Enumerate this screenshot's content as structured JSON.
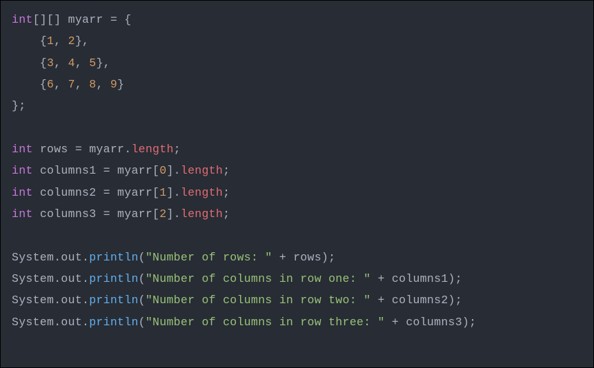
{
  "language": "java",
  "code": {
    "line1": {
      "kw": "int",
      "brackets": "[][] ",
      "var": "myarr ",
      "eq": "= ",
      "brace": "{"
    },
    "arr_row1": "    {",
    "arr_row1_v1": "1",
    "arr_row1_c1": ", ",
    "arr_row1_v2": "2",
    "arr_row1_end": "},",
    "arr_row2": "    {",
    "arr_row2_v1": "3",
    "arr_row2_c1": ", ",
    "arr_row2_v2": "4",
    "arr_row2_c2": ", ",
    "arr_row2_v3": "5",
    "arr_row2_end": "},",
    "arr_row3": "    {",
    "arr_row3_v1": "6",
    "arr_row3_c1": ", ",
    "arr_row3_v2": "7",
    "arr_row3_c2": ", ",
    "arr_row3_v3": "8",
    "arr_row3_c3": ", ",
    "arr_row3_v4": "9",
    "arr_row3_end": "}",
    "close": "};",
    "blank": " ",
    "rows_decl": {
      "kw": "int",
      "sp": " ",
      "var": "rows ",
      "eq": "= ",
      "src": "myarr",
      "dot": ".",
      "prop": "length",
      "semi": ";"
    },
    "col1_decl": {
      "kw": "int",
      "sp": " ",
      "var": "columns1 ",
      "eq": "= ",
      "src": "myarr[",
      "idx": "0",
      "rb": "]",
      "dot": ".",
      "prop": "length",
      "semi": ";"
    },
    "col2_decl": {
      "kw": "int",
      "sp": " ",
      "var": "columns2 ",
      "eq": "= ",
      "src": "myarr[",
      "idx": "1",
      "rb": "]",
      "dot": ".",
      "prop": "length",
      "semi": ";"
    },
    "col3_decl": {
      "kw": "int",
      "sp": " ",
      "var": "columns3 ",
      "eq": "= ",
      "src": "myarr[",
      "idx": "2",
      "rb": "]",
      "dot": ".",
      "prop": "length",
      "semi": ";"
    },
    "p1": {
      "sys": "System",
      "d1": ".",
      "out": "out",
      "d2": ".",
      "m": "println",
      "lp": "(",
      "str": "\"Number of rows: \"",
      "plus": " + ",
      "var": "rows",
      "rp": ");"
    },
    "p2": {
      "sys": "System",
      "d1": ".",
      "out": "out",
      "d2": ".",
      "m": "println",
      "lp": "(",
      "str": "\"Number of columns in row one: \"",
      "plus": " + ",
      "var": "columns1",
      "rp": ");"
    },
    "p3": {
      "sys": "System",
      "d1": ".",
      "out": "out",
      "d2": ".",
      "m": "println",
      "lp": "(",
      "str": "\"Number of columns in row two: \"",
      "plus": " + ",
      "var": "columns2",
      "rp": ");"
    },
    "p4": {
      "sys": "System",
      "d1": ".",
      "out": "out",
      "d2": ".",
      "m": "println",
      "lp": "(",
      "str": "\"Number of columns in row three: \"",
      "plus": " + ",
      "var": "columns3",
      "rp": ");"
    }
  }
}
